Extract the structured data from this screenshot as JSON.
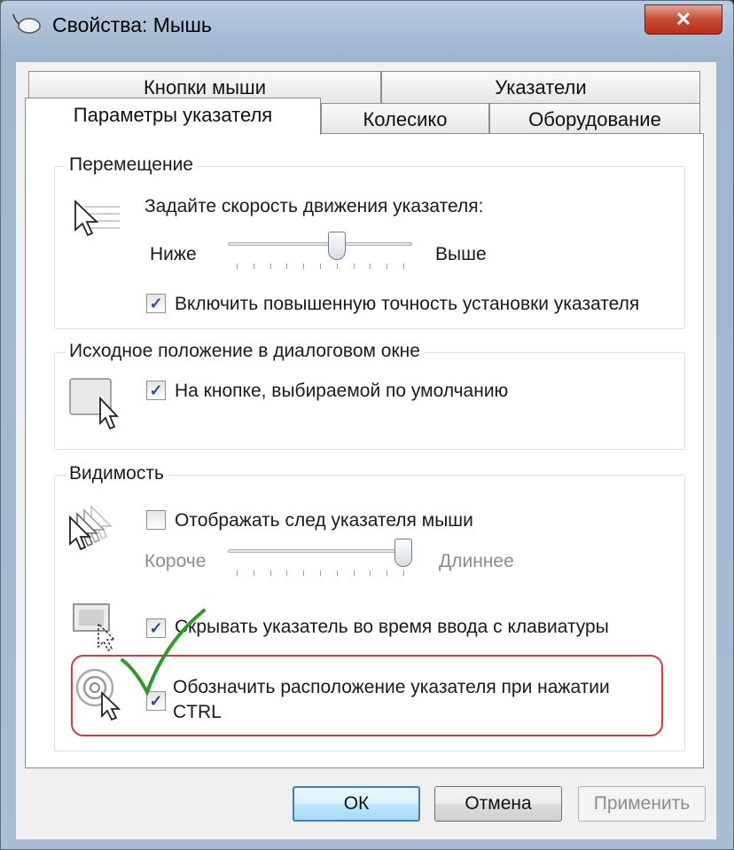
{
  "window": {
    "title": "Свойства: Мышь",
    "close_label": "✕"
  },
  "tabs": [
    {
      "label": "Кнопки мыши"
    },
    {
      "label": "Указатели"
    },
    {
      "label": "Параметры указателя",
      "active": true
    },
    {
      "label": "Колесико"
    },
    {
      "label": "Оборудование"
    }
  ],
  "motion": {
    "title": "Перемещение",
    "prompt": "Задайте скорость движения указателя:",
    "slow_label": "Ниже",
    "fast_label": "Выше",
    "speed_level": 0.6,
    "precision_label": "Включить повышенную точность установки указателя",
    "precision_checked": true
  },
  "snap": {
    "title": "Исходное положение в диалоговом окне",
    "label": "На кнопке, выбираемой по умолчанию",
    "checked": true
  },
  "visibility": {
    "title": "Видимость",
    "trails_label": "Отображать след указателя мыши",
    "trails_checked": false,
    "short_label": "Короче",
    "long_label": "Длиннее",
    "trails_level": 1.0,
    "hide_label": "Скрывать указатель во время ввода с клавиатуры",
    "hide_checked": true,
    "ctrl_label_line1": "Обозначить расположение указателя при нажатии",
    "ctrl_label_line2": "CTRL",
    "ctrl_checked": true
  },
  "buttons": {
    "ok": "ОК",
    "cancel": "Отмена",
    "apply": "Применить"
  },
  "colors": {
    "highlight": "#d7373f",
    "annotation_check": "#2e9a2a"
  }
}
